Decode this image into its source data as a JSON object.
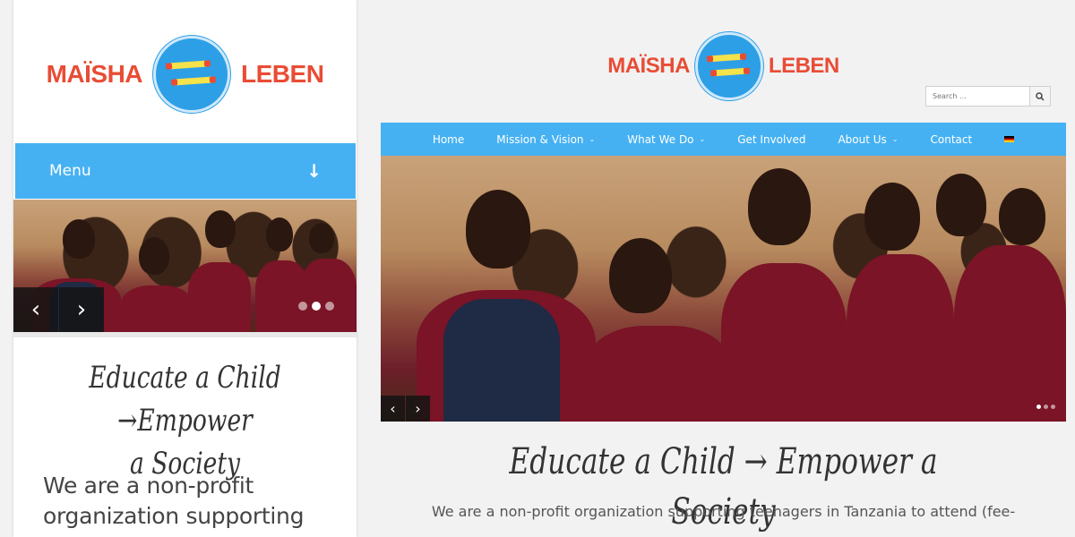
{
  "brand": {
    "left_word": "MAÏSHA",
    "right_word": "LEBEN",
    "logo_icon": "pencils-circle-logo",
    "colors": {
      "accent": "#46b1f2",
      "brand_red": "#e94c35",
      "pencil_yellow": "#f6e24a"
    }
  },
  "mobile": {
    "menu_label": "Menu",
    "menu_icon": "arrow-down-icon",
    "prev_arrow": "‹",
    "next_arrow": "›",
    "tagline_line1": "Educate a Child →Empower",
    "tagline_line2": "a Society",
    "body_line1": "We are a non-profit",
    "body_line2": "organization supporting"
  },
  "desktop": {
    "search_placeholder": "Search ...",
    "search_icon": "search-icon",
    "nav": {
      "home": "Home",
      "mission": "Mission & Vision",
      "what": "What We Do",
      "involved": "Get Involved",
      "about": "About Us",
      "contact": "Contact",
      "language": "German flag"
    },
    "chevron": "⌄",
    "prev_arrow": "‹",
    "next_arrow": "›",
    "tagline": "Educate a Child → Empower a Society",
    "body": "We are a non-profit organization supporting teenagers in Tanzania to attend (fee-"
  }
}
